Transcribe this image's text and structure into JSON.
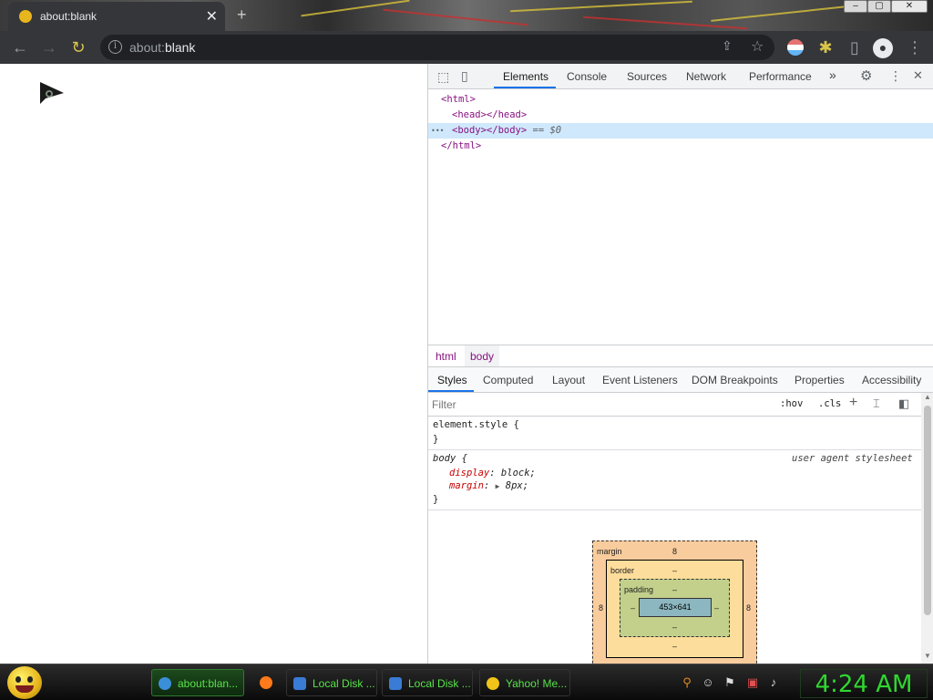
{
  "browser": {
    "tab_title": "about:blank",
    "tab_close": "✕",
    "new_tab": "+",
    "url_prefix": "about:",
    "url_host": "blank"
  },
  "devtools": {
    "tabs": [
      "Elements",
      "Console",
      "Sources",
      "Network",
      "Performance"
    ],
    "more_tabs": "»",
    "dom": {
      "html_open": "<html>",
      "head": "<head></head>",
      "dots": "•••",
      "body": "<body></body>",
      "body_eq": " == $0",
      "html_close": "</html>"
    },
    "breadcrumb": [
      "html",
      "body"
    ],
    "style_tabs": [
      "Styles",
      "Computed",
      "Layout",
      "Event Listeners",
      "DOM Breakpoints",
      "Properties",
      "Accessibility"
    ],
    "filter_placeholder": "Filter",
    "hov": ":hov",
    "cls": ".cls",
    "plus": "+",
    "element_style": "element.style {",
    "close_brace": "}",
    "body_rule": "body {",
    "ua_label": "user agent stylesheet",
    "props": [
      {
        "name": "display",
        "value": "block;"
      },
      {
        "name": "margin",
        "value": "8px;"
      }
    ],
    "box_model": {
      "margin_label": "margin",
      "margin_top": "8",
      "margin_left": "8",
      "margin_right": "8",
      "border_label": "border",
      "border_top": "–",
      "padding_label": "padding",
      "padding_top": "–",
      "padding_left": "–",
      "padding_right": "–",
      "padding_bottom": "–",
      "border_bottom": "–",
      "content": "453×641"
    }
  },
  "taskbar": {
    "tasks": [
      {
        "label": "about:blan...",
        "color": "#3b8fd8"
      },
      {
        "label": "",
        "color": "#ff7a1a"
      },
      {
        "label": "Local Disk ...",
        "color": "#3a7bd5"
      },
      {
        "label": "Local Disk ...",
        "color": "#3a7bd5"
      },
      {
        "label": "Yahoo! Me...",
        "color": "#f0c419"
      }
    ],
    "clock": "4:24 AM"
  }
}
